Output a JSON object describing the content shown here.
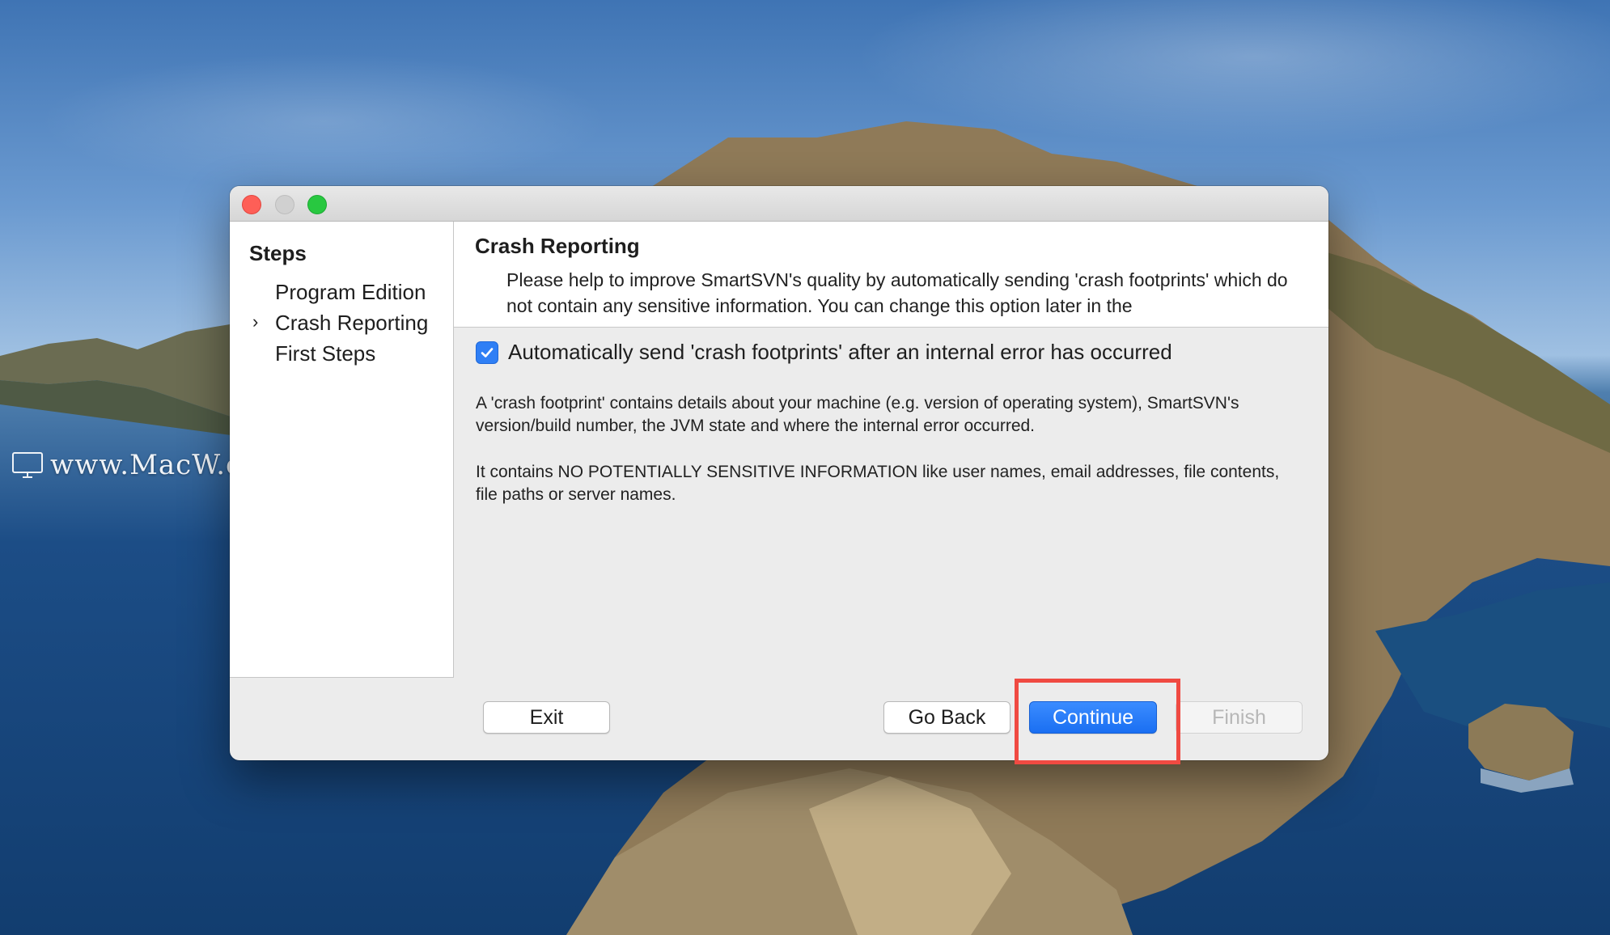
{
  "watermark": {
    "text": "www.MacW.com"
  },
  "dialog": {
    "sidebar": {
      "title": "Steps",
      "steps": [
        {
          "label": "Program Edition",
          "current": false
        },
        {
          "label": "Crash Reporting",
          "current": true
        },
        {
          "label": "First Steps",
          "current": false
        }
      ]
    },
    "content": {
      "title": "Crash Reporting",
      "intro": "Please help to improve SmartSVN's quality by automatically sending 'crash footprints' which do not contain any sensitive information. You can change this option later in the",
      "checkbox": {
        "label": "Automatically send 'crash footprints' after an internal error has occurred",
        "checked": true
      },
      "paragraph1": "A 'crash footprint' contains details about your machine (e.g. version of operating system), SmartSVN's version/build number, the JVM state and where the internal error occurred.",
      "paragraph2": "It contains NO POTENTIALLY SENSITIVE INFORMATION like user names, email addresses, file contents, file paths or server names."
    },
    "buttons": {
      "exit": "Exit",
      "go_back": "Go Back",
      "continue": "Continue",
      "finish": "Finish"
    }
  },
  "colors": {
    "primary_button": "#1a6ff2",
    "highlight_box": "#f04a42",
    "checkbox": "#2f7ff5"
  },
  "icons": {
    "current_step": "chevron-right-icon",
    "checkbox_mark": "checkmark-icon"
  }
}
